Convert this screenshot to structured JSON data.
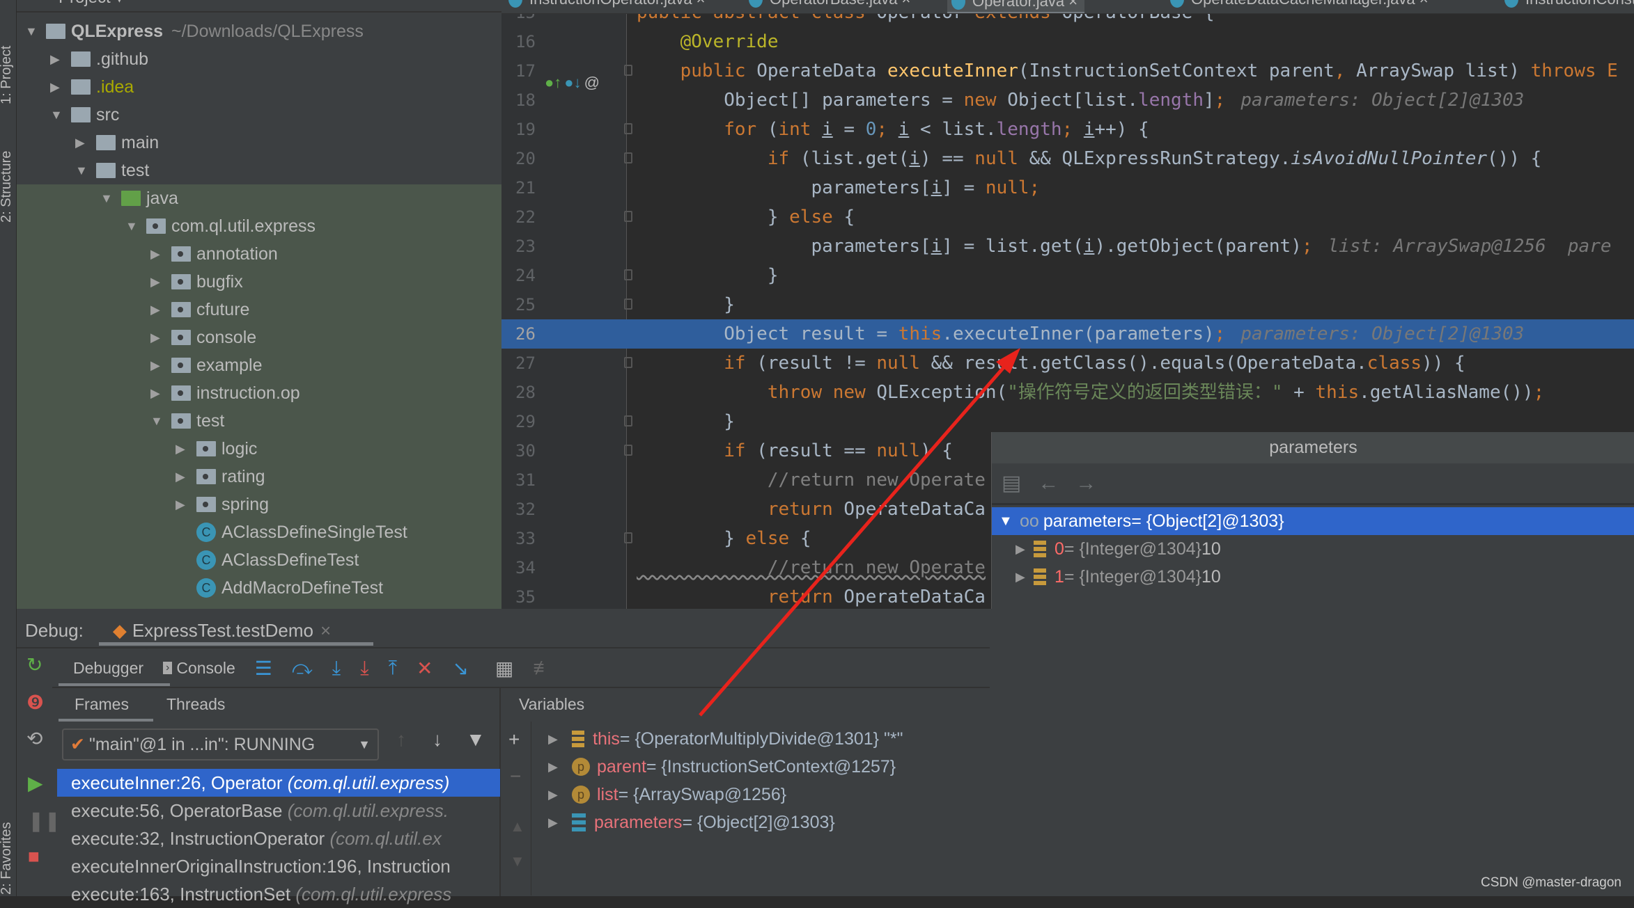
{
  "left_strip": {
    "project": "1: Project",
    "structure": "2: Structure",
    "favorites": "2: Favorites"
  },
  "project": {
    "title": "Project ▾",
    "tree": [
      {
        "label": "QLExpress",
        "suffix": "~/Downloads/QLExpress",
        "depth": 0,
        "arrow": "▼",
        "icon": "module"
      },
      {
        "label": ".github",
        "depth": 1,
        "arrow": "▶",
        "icon": "folder"
      },
      {
        "label": ".idea",
        "depth": 1,
        "arrow": "▶",
        "icon": "folder",
        "color": "#aaaa00"
      },
      {
        "label": "src",
        "depth": 1,
        "arrow": "▼",
        "icon": "folder"
      },
      {
        "label": "main",
        "depth": 2,
        "arrow": "▶",
        "icon": "folder"
      },
      {
        "label": "test",
        "depth": 2,
        "arrow": "▼",
        "icon": "folder"
      },
      {
        "label": "java",
        "depth": 3,
        "arrow": "▼",
        "icon": "src"
      },
      {
        "label": "com.ql.util.express",
        "depth": 4,
        "arrow": "▼",
        "icon": "pkg"
      },
      {
        "label": "annotation",
        "depth": 5,
        "arrow": "▶",
        "icon": "pkg"
      },
      {
        "label": "bugfix",
        "depth": 5,
        "arrow": "▶",
        "icon": "pkg"
      },
      {
        "label": "cfuture",
        "depth": 5,
        "arrow": "▶",
        "icon": "pkg"
      },
      {
        "label": "console",
        "depth": 5,
        "arrow": "▶",
        "icon": "pkg"
      },
      {
        "label": "example",
        "depth": 5,
        "arrow": "▶",
        "icon": "pkg"
      },
      {
        "label": "instruction.op",
        "depth": 5,
        "arrow": "▶",
        "icon": "pkg"
      },
      {
        "label": "test",
        "depth": 5,
        "arrow": "▼",
        "icon": "pkg"
      },
      {
        "label": "logic",
        "depth": 6,
        "arrow": "▶",
        "icon": "pkg"
      },
      {
        "label": "rating",
        "depth": 6,
        "arrow": "▶",
        "icon": "pkg"
      },
      {
        "label": "spring",
        "depth": 6,
        "arrow": "▶",
        "icon": "pkg"
      },
      {
        "label": "AClassDefineSingleTest",
        "depth": 6,
        "arrow": "",
        "icon": "class"
      },
      {
        "label": "AClassDefineTest",
        "depth": 6,
        "arrow": "",
        "icon": "class"
      },
      {
        "label": "AddMacroDefineTest",
        "depth": 6,
        "arrow": "",
        "icon": "class"
      }
    ]
  },
  "tabs": [
    {
      "label": "InstructionOperator.java ×"
    },
    {
      "label": "OperatorBase.java ×"
    },
    {
      "label": "Operator.java ×",
      "active": true
    },
    {
      "label": "OperateDataCacheManager.java ×"
    },
    {
      "label": "InstructionConstS"
    }
  ],
  "editor": {
    "current_line": 26,
    "lines": [
      {
        "n": 15,
        "tokens": [
          [
            "k",
            "public abstract class "
          ],
          [
            "t",
            "Operator "
          ],
          [
            "k",
            "extends "
          ],
          [
            "t",
            "OperatorBase {"
          ]
        ]
      },
      {
        "n": 16,
        "tokens": [
          [
            "a",
            "    @Override"
          ]
        ]
      },
      {
        "n": 17,
        "tokens": [
          [
            "k",
            "    public "
          ],
          [
            "t",
            "OperateData "
          ],
          [
            "m",
            "executeInner"
          ],
          [
            "t",
            "(InstructionSetContext parent"
          ],
          [
            "k",
            ", "
          ],
          [
            "t",
            "ArraySwap list) "
          ],
          [
            "k",
            "throws E"
          ]
        ],
        "fold": true
      },
      {
        "n": 18,
        "tokens": [
          [
            "t",
            "        Object[] parameters = "
          ],
          [
            "k",
            "new "
          ],
          [
            "t",
            "Object[list."
          ],
          [
            "f",
            "length"
          ],
          [
            "t",
            "]"
          ],
          [
            "k",
            ";"
          ]
        ],
        "hint": "parameters: Object[2]@1303"
      },
      {
        "n": 19,
        "tokens": [
          [
            "k",
            "        for "
          ],
          [
            "t",
            "("
          ],
          [
            "k",
            "int "
          ],
          [
            "u",
            "i"
          ],
          [
            "t",
            " = "
          ],
          [
            "n",
            "0"
          ],
          [
            "k",
            "; "
          ],
          [
            "u",
            "i"
          ],
          [
            "t",
            " < list."
          ],
          [
            "f",
            "length"
          ],
          [
            "k",
            "; "
          ],
          [
            "u",
            "i"
          ],
          [
            "t",
            "++) {"
          ]
        ],
        "fold": true
      },
      {
        "n": 20,
        "tokens": [
          [
            "k",
            "            if "
          ],
          [
            "t",
            "(list.get("
          ],
          [
            "u",
            "i"
          ],
          [
            "t",
            ") == "
          ],
          [
            "k",
            "null "
          ],
          [
            "t",
            "&& QLExpressRunStrategy."
          ],
          [
            "it",
            "isAvoidNullPointer"
          ],
          [
            "t",
            "()) {"
          ]
        ],
        "fold": true
      },
      {
        "n": 21,
        "tokens": [
          [
            "t",
            "                parameters["
          ],
          [
            "u",
            "i"
          ],
          [
            "t",
            "] = "
          ],
          [
            "k",
            "null;"
          ]
        ]
      },
      {
        "n": 22,
        "tokens": [
          [
            "t",
            "            } "
          ],
          [
            "k",
            "else "
          ],
          [
            "t",
            "{"
          ]
        ],
        "fold": true
      },
      {
        "n": 23,
        "tokens": [
          [
            "t",
            "                parameters["
          ],
          [
            "u",
            "i"
          ],
          [
            "t",
            "] = list.get("
          ],
          [
            "u",
            "i"
          ],
          [
            "t",
            ").getObject(parent)"
          ],
          [
            "k",
            ";"
          ]
        ],
        "hint": "list: ArraySwap@1256  pare"
      },
      {
        "n": 24,
        "tokens": [
          [
            "t",
            "            }"
          ]
        ],
        "fold": true
      },
      {
        "n": 25,
        "tokens": [
          [
            "t",
            "        }"
          ]
        ],
        "fold": true
      },
      {
        "n": 26,
        "tokens": [
          [
            "t",
            "        Object result = "
          ],
          [
            "k",
            "this"
          ],
          [
            "t",
            ".executeInner(parameters)"
          ],
          [
            "k",
            ";"
          ]
        ],
        "hint": "parameters: Object[2]@1303"
      },
      {
        "n": 27,
        "tokens": [
          [
            "k",
            "        if "
          ],
          [
            "t",
            "(result != "
          ],
          [
            "k",
            "null "
          ],
          [
            "t",
            "&& result.getClass().equals(OperateData."
          ],
          [
            "k",
            "class"
          ],
          [
            "t",
            ")) {"
          ]
        ],
        "fold": true
      },
      {
        "n": 28,
        "tokens": [
          [
            "k",
            "            throw new "
          ],
          [
            "t",
            "QLException("
          ],
          [
            "s",
            "\"操作符号定义的返回类型错误：\""
          ],
          [
            "t",
            " + "
          ],
          [
            "k",
            "this"
          ],
          [
            "t",
            ".getAliasName())"
          ],
          [
            "k",
            ";"
          ]
        ]
      },
      {
        "n": 29,
        "tokens": [
          [
            "t",
            "        }"
          ]
        ],
        "fold": true
      },
      {
        "n": 30,
        "tokens": [
          [
            "k",
            "        if "
          ],
          [
            "t",
            "(result == "
          ],
          [
            "k",
            "null"
          ],
          [
            "t",
            ") {"
          ]
        ],
        "fold": true
      },
      {
        "n": 31,
        "tokens": [
          [
            "c",
            "            //return new Operate"
          ]
        ]
      },
      {
        "n": 32,
        "tokens": [
          [
            "k",
            "            return "
          ],
          [
            "t",
            "OperateDataCa"
          ]
        ]
      },
      {
        "n": 33,
        "tokens": [
          [
            "t",
            "        } "
          ],
          [
            "k",
            "else "
          ],
          [
            "t",
            "{"
          ]
        ],
        "fold": true
      },
      {
        "n": 34,
        "tokens": [
          [
            "cw",
            "            //return new Operate"
          ]
        ]
      },
      {
        "n": 35,
        "tokens": [
          [
            "k",
            "            return "
          ],
          [
            "t",
            "OperateDataCa"
          ]
        ]
      }
    ]
  },
  "popup": {
    "title": "parameters",
    "root": {
      "name": "parameters",
      "value": " = {Object[2]@1303}"
    },
    "children": [
      {
        "index": "0",
        "ref": " = {Integer@1304}",
        "value": " 10"
      },
      {
        "index": "1",
        "ref": " = {Integer@1304}",
        "value": " 10"
      }
    ]
  },
  "debug": {
    "label": "Debug:",
    "session": "ExpressTest.testDemo",
    "close": "×",
    "tabs": {
      "debugger": "Debugger",
      "console": "Console"
    },
    "subtabs": {
      "frames": "Frames",
      "threads": "Threads",
      "variables": "Variables"
    },
    "thread": "\"main\"@1 in ...in\": RUNNING",
    "frames": [
      {
        "method": "executeInner:26, Operator ",
        "pkg": "(com.ql.util.express)",
        "selected": true
      },
      {
        "method": "execute:56, OperatorBase ",
        "pkg": "(com.ql.util.express."
      },
      {
        "method": "execute:32, InstructionOperator ",
        "pkg": "(com.ql.util.ex"
      },
      {
        "method": "executeInnerOriginalInstruction:196, Instruction",
        "pkg": ""
      },
      {
        "method": "execute:163, InstructionSet ",
        "pkg": "(com.ql.util.express"
      }
    ],
    "variables": [
      {
        "name": "this",
        "value": " = {OperatorMultiplyDivide@1301} \"*\"",
        "icon": "field"
      },
      {
        "name": "parent",
        "value": " = {InstructionSetContext@1257}",
        "icon": "param"
      },
      {
        "name": "list",
        "value": " = {ArraySwap@1256}",
        "icon": "param"
      },
      {
        "name": "parameters",
        "value": " = {Object[2]@1303}",
        "icon": "array"
      }
    ]
  },
  "watermark": "CSDN @master-dragon",
  "colors": {
    "accent": "#2f65ca",
    "current_line": "#2f5e9c",
    "annotation_arrow": "#e8231c"
  }
}
